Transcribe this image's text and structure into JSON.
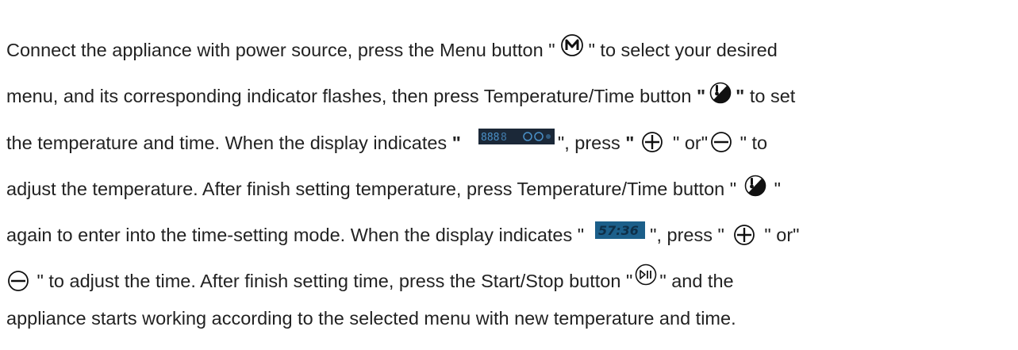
{
  "instructions": {
    "line1": {
      "t1": "Connect the appliance with power source, press the Menu button \"",
      "t2": "\" to select your desired"
    },
    "line2": {
      "t1": "menu, and its corresponding indicator flashes, then press Temperature/Time button ",
      "q_open": "\"",
      "q_close": "\"",
      "t2": " to set"
    },
    "line3": {
      "t1": "the temperature and time. When the display indicates ",
      "q_open": "\"",
      "t2": "\", press ",
      "q_open2": "\"",
      "t3": " \" or\"",
      "t4": " \" to"
    },
    "line4": {
      "t1": "adjust the temperature. After finish setting temperature, press Temperature/Time button \"",
      "t2": " \""
    },
    "line5": {
      "t1": "again to enter into the time-setting mode. When the display indicates \"",
      "t2": "\", press \"",
      "t3": " \" or\""
    },
    "line6": {
      "t1": " \" to adjust the time. After finish setting time, press the Start/Stop button \"",
      "t2": "\" and the"
    },
    "line7": {
      "t1": "appliance starts working according to the selected menu with new temperature and time."
    }
  },
  "icons": {
    "menu": "menu-button-icon",
    "temp_time": "temperature-time-button-icon",
    "plus": "plus-button-icon",
    "minus": "minus-button-icon",
    "start_stop": "start-stop-button-icon"
  },
  "displays": {
    "temperature_display": "888",
    "time_display": "57:36"
  },
  "colors": {
    "text": "#222222",
    "display_bg": "#1b2838",
    "display_segments": "#4a90c8"
  }
}
